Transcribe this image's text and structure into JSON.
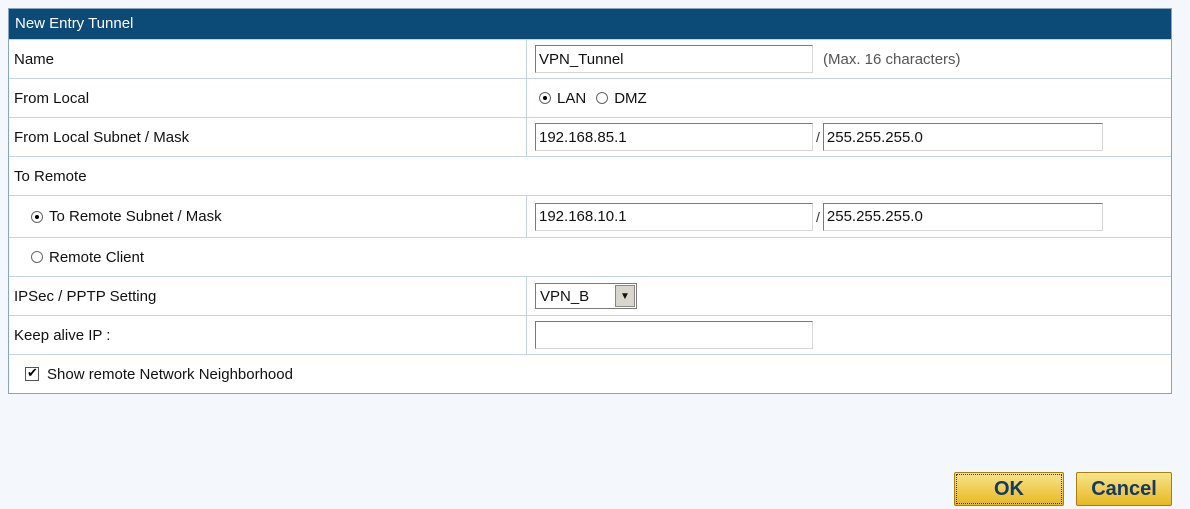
{
  "panel": {
    "title": "New Entry Tunnel"
  },
  "fields": {
    "name": {
      "label": "Name",
      "value": "VPN_Tunnel",
      "hint": "(Max. 16 characters)"
    },
    "from_local": {
      "label": "From Local",
      "options": [
        "LAN",
        "DMZ"
      ],
      "selected": "LAN"
    },
    "local_subnet": {
      "label": "From Local Subnet / Mask",
      "ip": "192.168.85.1",
      "mask": "255.255.255.0",
      "separator": "/"
    },
    "to_remote": {
      "label": "To Remote"
    },
    "remote_subnet": {
      "label": "To Remote Subnet / Mask",
      "selected": true,
      "ip": "192.168.10.1",
      "mask": "255.255.255.0",
      "separator": "/"
    },
    "remote_client": {
      "label": "Remote Client",
      "selected": false
    },
    "ipsec": {
      "label": "IPSec / PPTP Setting",
      "value": "VPN_B"
    },
    "keep_alive": {
      "label": "Keep alive IP :",
      "value": ""
    },
    "show_neighborhood": {
      "label": "Show remote Network Neighborhood",
      "checked": true
    }
  },
  "buttons": {
    "ok": "OK",
    "cancel": "Cancel"
  }
}
